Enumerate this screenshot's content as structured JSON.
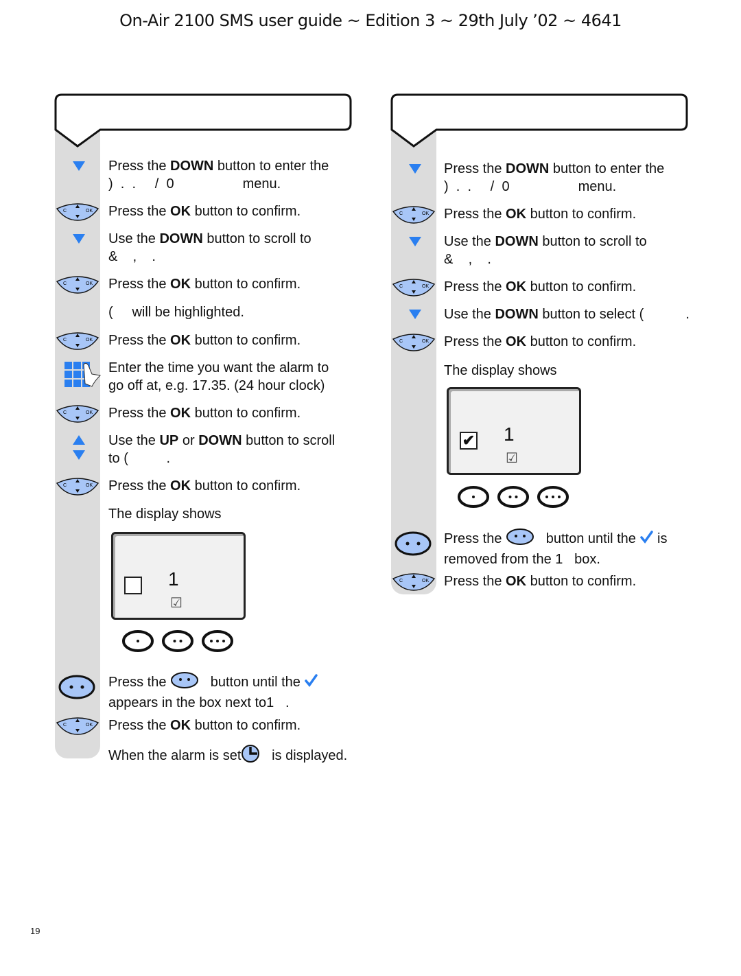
{
  "header": {
    "title": "On-Air 2100 SMS user guide ~ Edition 3 ~ 29th July ’02 ~ 4641"
  },
  "page_number": "19",
  "colors": {
    "accent_blue": "#2a7ff0",
    "button_fill": "#a8c6f7",
    "bar_gray": "#dcdcdc"
  },
  "left_column": {
    "steps": [
      {
        "icon": "down-arrow",
        "lines": [
          [
            {
              "t": "Press the "
            },
            {
              "b": "DOWN"
            },
            {
              "t": " button to enter the"
            }
          ],
          [
            {
              "t": ")  .  .     /  0                  menu."
            }
          ]
        ]
      },
      {
        "icon": "ok-nav-button",
        "lines": [
          [
            {
              "t": "Press the "
            },
            {
              "b": "OK"
            },
            {
              "t": " button to confirm."
            }
          ]
        ]
      },
      {
        "icon": "down-arrow",
        "lines": [
          [
            {
              "t": "Use the "
            },
            {
              "b": "DOWN"
            },
            {
              "t": " button to scroll to"
            }
          ],
          [
            {
              "t": "&    ,    ."
            }
          ]
        ]
      },
      {
        "icon": "ok-nav-button",
        "lines": [
          [
            {
              "t": "Press the "
            },
            {
              "b": "OK"
            },
            {
              "t": " button to confirm."
            }
          ]
        ]
      },
      {
        "icon": "",
        "lines": [
          [
            {
              "t": "(     will be highlighted."
            }
          ]
        ]
      },
      {
        "icon": "ok-nav-button",
        "lines": [
          [
            {
              "t": "Press the "
            },
            {
              "b": "OK"
            },
            {
              "t": " button to confirm."
            }
          ]
        ]
      },
      {
        "icon": "keypad",
        "lines": [
          [
            {
              "t": "Enter the time you want the alarm to"
            }
          ],
          [
            {
              "t": "go off at, e.g. 17.35. (24 hour clock)"
            }
          ]
        ]
      },
      {
        "icon": "ok-nav-button",
        "lines": [
          [
            {
              "t": "Press the "
            },
            {
              "b": "OK"
            },
            {
              "t": " button to confirm."
            }
          ]
        ]
      },
      {
        "icon": "up-down-arrows",
        "lines": [
          [
            {
              "t": "Use the "
            },
            {
              "b": "UP"
            },
            {
              "t": " or "
            },
            {
              "b": "DOWN"
            },
            {
              "t": " button to scroll"
            }
          ],
          [
            {
              "t": "to (          ."
            }
          ]
        ]
      },
      {
        "icon": "ok-nav-button",
        "lines": [
          [
            {
              "t": "Press the "
            },
            {
              "b": "OK"
            },
            {
              "t": " button to confirm."
            }
          ]
        ]
      },
      {
        "icon": "",
        "lines": [
          [
            {
              "t": "The display shows"
            }
          ]
        ]
      },
      {
        "icon": "softkey-two-dots",
        "lines": [
          [
            {
              "t": "Press the "
            },
            {
              "i": "softkey-inline"
            },
            {
              "t": "   button until the "
            },
            {
              "i": "check"
            }
          ],
          [
            {
              "t": "appears in the box next to1   ."
            }
          ]
        ]
      },
      {
        "icon": "ok-nav-button",
        "lines": [
          [
            {
              "t": "Press the "
            },
            {
              "b": "OK"
            },
            {
              "t": " button to confirm."
            }
          ]
        ]
      },
      {
        "icon": "",
        "lines": [
          [
            {
              "t": "When the alarm is set"
            },
            {
              "i": "clock"
            },
            {
              "t": "   is displayed."
            }
          ]
        ]
      }
    ],
    "display": {
      "checked": false,
      "number": "1",
      "small_box": "☑",
      "softkeys": [
        1,
        2,
        3
      ]
    }
  },
  "right_column": {
    "steps": [
      {
        "icon": "down-arrow",
        "lines": [
          [
            {
              "t": "Press the "
            },
            {
              "b": "DOWN"
            },
            {
              "t": " button to enter the"
            }
          ],
          [
            {
              "t": ")  .  .     /  0                  menu."
            }
          ]
        ]
      },
      {
        "icon": "ok-nav-button",
        "lines": [
          [
            {
              "t": "Press the "
            },
            {
              "b": "OK"
            },
            {
              "t": " button to confirm."
            }
          ]
        ]
      },
      {
        "icon": "down-arrow",
        "lines": [
          [
            {
              "t": "Use the "
            },
            {
              "b": "DOWN"
            },
            {
              "t": " button to scroll to"
            }
          ],
          [
            {
              "t": "&    ,    ."
            }
          ]
        ]
      },
      {
        "icon": "ok-nav-button",
        "lines": [
          [
            {
              "t": "Press the "
            },
            {
              "b": "OK"
            },
            {
              "t": " button to confirm."
            }
          ]
        ]
      },
      {
        "icon": "down-arrow",
        "lines": [
          [
            {
              "t": "Use the "
            },
            {
              "b": "DOWN"
            },
            {
              "t": " button to select (           ."
            }
          ]
        ]
      },
      {
        "icon": "ok-nav-button",
        "lines": [
          [
            {
              "t": "Press the "
            },
            {
              "b": "OK"
            },
            {
              "t": " button to confirm."
            }
          ]
        ]
      },
      {
        "icon": "",
        "lines": [
          [
            {
              "t": "The display shows"
            }
          ]
        ]
      },
      {
        "icon": "softkey-two-dots",
        "lines": [
          [
            {
              "t": "Press the "
            },
            {
              "i": "softkey-inline"
            },
            {
              "t": "   button until the "
            },
            {
              "i": "check"
            },
            {
              "t": " is"
            }
          ],
          [
            {
              "t": "removed from the 1   box."
            }
          ]
        ]
      },
      {
        "icon": "ok-nav-button",
        "lines": [
          [
            {
              "t": "Press the "
            },
            {
              "b": "OK"
            },
            {
              "t": " button to confirm."
            }
          ]
        ]
      }
    ],
    "display": {
      "checked": true,
      "number": "1",
      "small_box": "☑",
      "softkeys": [
        1,
        2,
        3
      ]
    }
  }
}
